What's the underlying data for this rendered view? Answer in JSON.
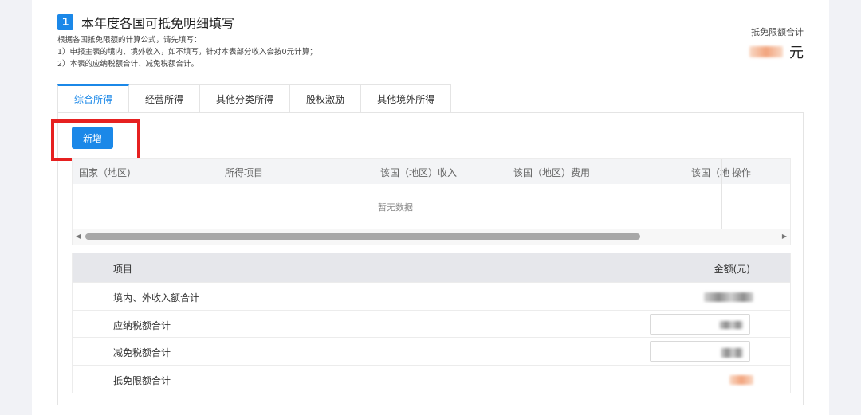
{
  "section": {
    "number": "1",
    "title": "本年度各国可抵免明细填写",
    "notes": [
      "根据各国抵免限额的计算公式，请先填写：",
      "1）申报主表的境内、境外收入，如不填写，针对本表部分收入会按0元计算；",
      "2）本表的应纳税额合计、减免税额合计。"
    ]
  },
  "total": {
    "label": "抵免限额合计",
    "unit": "元"
  },
  "tabs": [
    {
      "label": "综合所得",
      "active": true
    },
    {
      "label": "经营所得",
      "active": false
    },
    {
      "label": "其他分类所得",
      "active": false
    },
    {
      "label": "股权激励",
      "active": false
    },
    {
      "label": "其他境外所得",
      "active": false
    }
  ],
  "add_button": "新增",
  "grid": {
    "columns": [
      "国家（地区)",
      "所得项目",
      "该国（地区）收入",
      "该国（地区）费用",
      "该国（地"
    ],
    "op_column": "操作",
    "empty_text": "暂无数据"
  },
  "summary": {
    "header_item": "项目",
    "header_amount": "金额(元)",
    "rows": [
      {
        "label": "境内、外收入额合计"
      },
      {
        "label": "应纳税额合计"
      },
      {
        "label": "减免税额合计"
      },
      {
        "label": "抵免限额合计"
      }
    ]
  },
  "colors": {
    "accent": "#1b88e8",
    "highlight": "#e62020"
  }
}
